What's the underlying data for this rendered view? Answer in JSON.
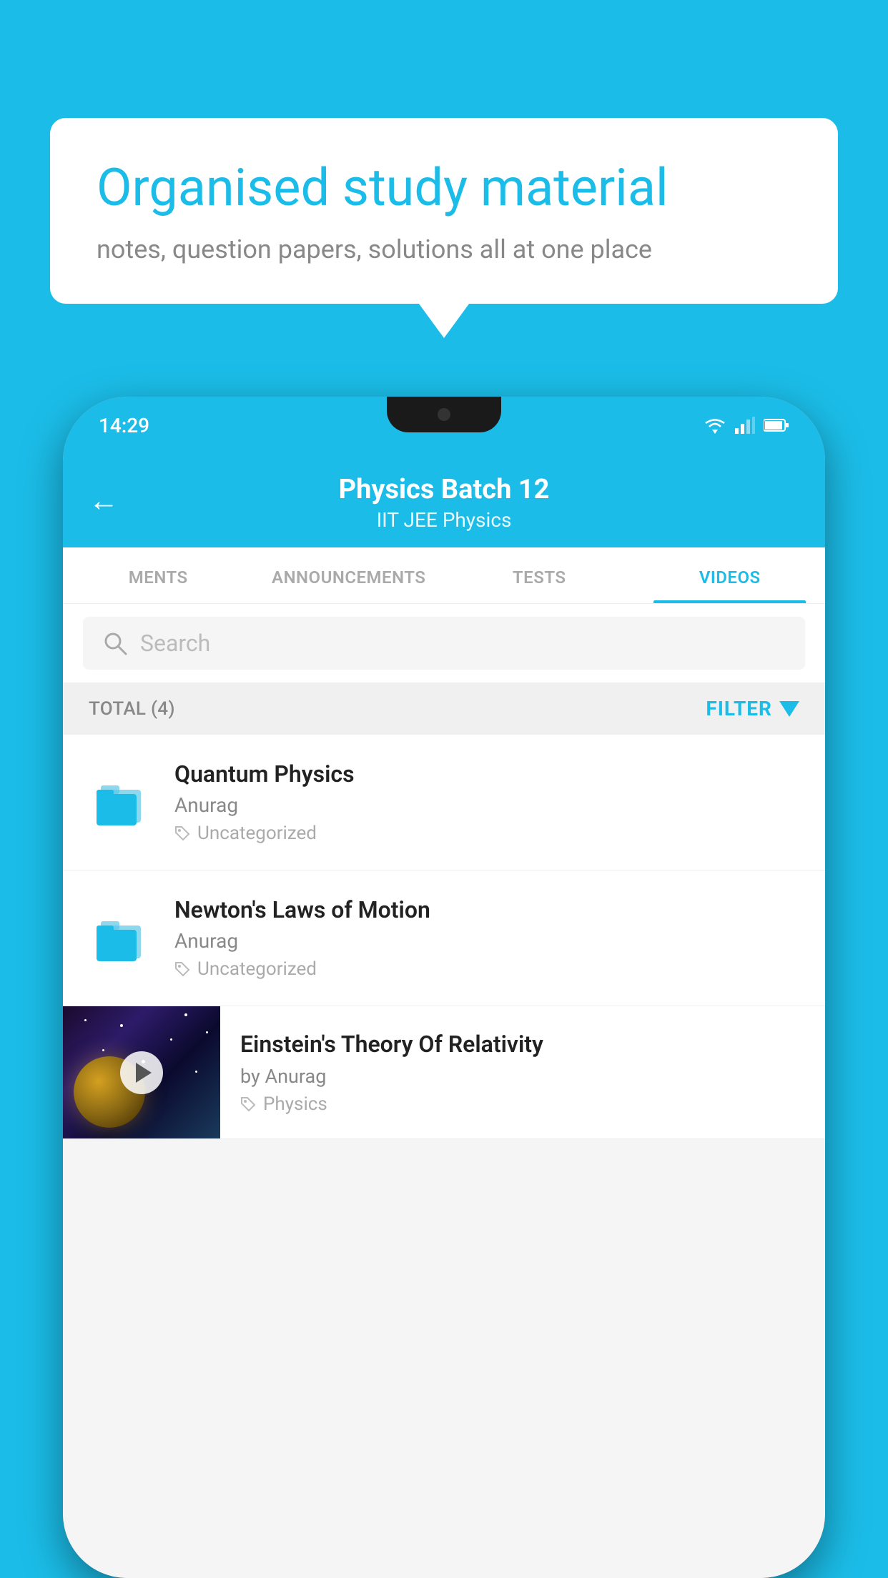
{
  "background_color": "#1bbde8",
  "bubble": {
    "title": "Organised study material",
    "subtitle": "notes, question papers, solutions all at one place"
  },
  "phone": {
    "status_time": "14:29",
    "header": {
      "title": "Physics Batch 12",
      "subtitle_tags": "IIT JEE    Physics",
      "back_label": "←"
    },
    "tabs": [
      {
        "label": "MENTS",
        "active": false
      },
      {
        "label": "ANNOUNCEMENTS",
        "active": false
      },
      {
        "label": "TESTS",
        "active": false
      },
      {
        "label": "VIDEOS",
        "active": true
      }
    ],
    "search": {
      "placeholder": "Search"
    },
    "filter": {
      "total_label": "TOTAL (4)",
      "filter_label": "FILTER"
    },
    "videos": [
      {
        "id": 1,
        "title": "Quantum Physics",
        "author": "Anurag",
        "tag": "Uncategorized",
        "type": "folder"
      },
      {
        "id": 2,
        "title": "Newton's Laws of Motion",
        "author": "Anurag",
        "tag": "Uncategorized",
        "type": "folder"
      },
      {
        "id": 3,
        "title": "Einstein's Theory Of Relativity",
        "author": "by Anurag",
        "tag": "Physics",
        "type": "video"
      }
    ]
  }
}
